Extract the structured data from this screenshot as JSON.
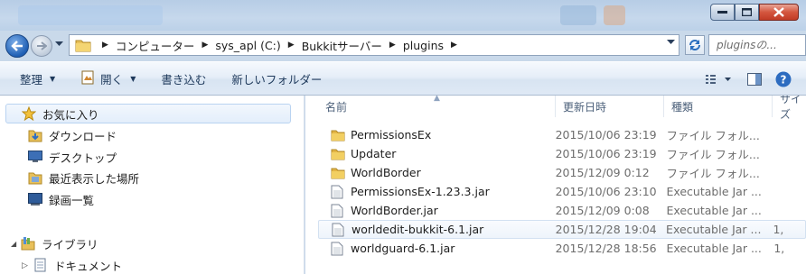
{
  "window": {
    "controls": {
      "minimize": "minimize-icon",
      "maximize": "maximize-icon",
      "close": "close-icon"
    }
  },
  "address": {
    "breadcrumbs": [
      "コンピューター",
      "sys_apl (C:)",
      "Bukkitサーバー",
      "plugins"
    ],
    "search_placeholder": "pluginsの..."
  },
  "toolbar": {
    "organize": "整理",
    "open": "開く",
    "burn": "書き込む",
    "new_folder": "新しいフォルダー"
  },
  "nav": {
    "favorites": "お気に入り",
    "downloads": "ダウンロード",
    "desktop": "デスクトップ",
    "recent": "最近表示した場所",
    "recorded_tv": "録画一覧",
    "libraries": "ライブラリ",
    "documents": "ドキュメント"
  },
  "columns": {
    "name": "名前",
    "date": "更新日時",
    "type": "種類",
    "size": "サイズ"
  },
  "files": [
    {
      "name": "PermissionsEx",
      "date": "2015/10/06 23:19",
      "type": "ファイル フォル...",
      "size": "",
      "icon": "folder-icon"
    },
    {
      "name": "Updater",
      "date": "2015/10/06 23:19",
      "type": "ファイル フォル...",
      "size": "",
      "icon": "folder-icon"
    },
    {
      "name": "WorldBorder",
      "date": "2015/12/09 0:12",
      "type": "ファイル フォル...",
      "size": "",
      "icon": "folder-icon"
    },
    {
      "name": "PermissionsEx-1.23.3.jar",
      "date": "2015/10/06 23:10",
      "type": "Executable Jar ...",
      "size": "",
      "icon": "jar-file-icon"
    },
    {
      "name": "WorldBorder.jar",
      "date": "2015/12/09 0:08",
      "type": "Executable Jar ...",
      "size": "",
      "icon": "jar-file-icon"
    },
    {
      "name": "worldedit-bukkit-6.1.jar",
      "date": "2015/12/28 19:04",
      "type": "Executable Jar ...",
      "size": "1,",
      "icon": "jar-file-icon"
    },
    {
      "name": "worldguard-6.1.jar",
      "date": "2015/12/28 18:56",
      "type": "Executable Jar ...",
      "size": "1,",
      "icon": "jar-file-icon"
    }
  ],
  "colors": {
    "accent": "#1e395b",
    "selection": "#d3e1f1"
  }
}
